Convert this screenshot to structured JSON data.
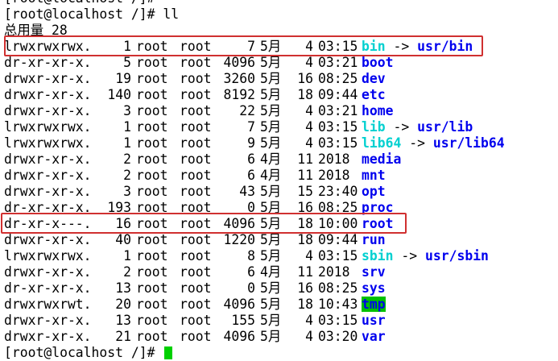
{
  "prev_prompt": "[root@localhost /]#",
  "prompt": "[root@localhost /]# ll",
  "total": "总用量 28",
  "entries": [
    {
      "perm": "lrwxrwxrwx.",
      "links": "1",
      "owner": "root",
      "group": "root",
      "size": "7",
      "month": "5月",
      "day": "4",
      "time": "03:15",
      "name": "bin",
      "type": "link",
      "target": "usr/bin"
    },
    {
      "perm": "dr-xr-xr-x.",
      "links": "5",
      "owner": "root",
      "group": "root",
      "size": "4096",
      "month": "5月",
      "day": "4",
      "time": "03:21",
      "name": "boot",
      "type": "dir"
    },
    {
      "perm": "drwxr-xr-x.",
      "links": "19",
      "owner": "root",
      "group": "root",
      "size": "3260",
      "month": "5月",
      "day": "16",
      "time": "08:25",
      "name": "dev",
      "type": "dir"
    },
    {
      "perm": "drwxr-xr-x.",
      "links": "140",
      "owner": "root",
      "group": "root",
      "size": "8192",
      "month": "5月",
      "day": "18",
      "time": "09:44",
      "name": "etc",
      "type": "dir"
    },
    {
      "perm": "drwxr-xr-x.",
      "links": "3",
      "owner": "root",
      "group": "root",
      "size": "22",
      "month": "5月",
      "day": "4",
      "time": "03:21",
      "name": "home",
      "type": "dir"
    },
    {
      "perm": "lrwxrwxrwx.",
      "links": "1",
      "owner": "root",
      "group": "root",
      "size": "7",
      "month": "5月",
      "day": "4",
      "time": "03:15",
      "name": "lib",
      "type": "link",
      "target": "usr/lib"
    },
    {
      "perm": "lrwxrwxrwx.",
      "links": "1",
      "owner": "root",
      "group": "root",
      "size": "9",
      "month": "5月",
      "day": "4",
      "time": "03:15",
      "name": "lib64",
      "type": "link",
      "target": "usr/lib64"
    },
    {
      "perm": "drwxr-xr-x.",
      "links": "2",
      "owner": "root",
      "group": "root",
      "size": "6",
      "month": "4月",
      "day": "11",
      "time": "2018",
      "name": "media",
      "type": "dir"
    },
    {
      "perm": "drwxr-xr-x.",
      "links": "2",
      "owner": "root",
      "group": "root",
      "size": "6",
      "month": "4月",
      "day": "11",
      "time": "2018",
      "name": "mnt",
      "type": "dir"
    },
    {
      "perm": "drwxr-xr-x.",
      "links": "3",
      "owner": "root",
      "group": "root",
      "size": "43",
      "month": "5月",
      "day": "15",
      "time": "23:40",
      "name": "opt",
      "type": "dir"
    },
    {
      "perm": "dr-xr-xr-x.",
      "links": "193",
      "owner": "root",
      "group": "root",
      "size": "0",
      "month": "5月",
      "day": "16",
      "time": "08:25",
      "name": "proc",
      "type": "dir"
    },
    {
      "perm": "dr-xr-x---.",
      "links": "16",
      "owner": "root",
      "group": "root",
      "size": "4096",
      "month": "5月",
      "day": "18",
      "time": "10:00",
      "name": "root",
      "type": "dir"
    },
    {
      "perm": "drwxr-xr-x.",
      "links": "40",
      "owner": "root",
      "group": "root",
      "size": "1220",
      "month": "5月",
      "day": "18",
      "time": "09:44",
      "name": "run",
      "type": "dir"
    },
    {
      "perm": "lrwxrwxrwx.",
      "links": "1",
      "owner": "root",
      "group": "root",
      "size": "8",
      "month": "5月",
      "day": "4",
      "time": "03:15",
      "name": "sbin",
      "type": "link",
      "target": "usr/sbin"
    },
    {
      "perm": "drwxr-xr-x.",
      "links": "2",
      "owner": "root",
      "group": "root",
      "size": "6",
      "month": "4月",
      "day": "11",
      "time": "2018",
      "name": "srv",
      "type": "dir"
    },
    {
      "perm": "dr-xr-xr-x.",
      "links": "13",
      "owner": "root",
      "group": "root",
      "size": "0",
      "month": "5月",
      "day": "16",
      "time": "08:25",
      "name": "sys",
      "type": "dir"
    },
    {
      "perm": "drwxrwxrwt.",
      "links": "20",
      "owner": "root",
      "group": "root",
      "size": "4096",
      "month": "5月",
      "day": "18",
      "time": "10:43",
      "name": "tmp",
      "type": "sticky"
    },
    {
      "perm": "drwxr-xr-x.",
      "links": "13",
      "owner": "root",
      "group": "root",
      "size": "155",
      "month": "5月",
      "day": "4",
      "time": "03:15",
      "name": "usr",
      "type": "dir"
    },
    {
      "perm": "drwxr-xr-x.",
      "links": "21",
      "owner": "root",
      "group": "root",
      "size": "4096",
      "month": "5月",
      "day": "4",
      "time": "03:20",
      "name": "var",
      "type": "dir"
    }
  ],
  "arrow": "->",
  "last_prompt": "[root@localhost /]#",
  "colors": {
    "dir": "#0000ee",
    "link": "#00d0d0",
    "sticky_bg": "#00c000",
    "highlight": "#d03030",
    "cursor": "#00d000"
  },
  "highlighted_entries": [
    "bin",
    "root"
  ]
}
